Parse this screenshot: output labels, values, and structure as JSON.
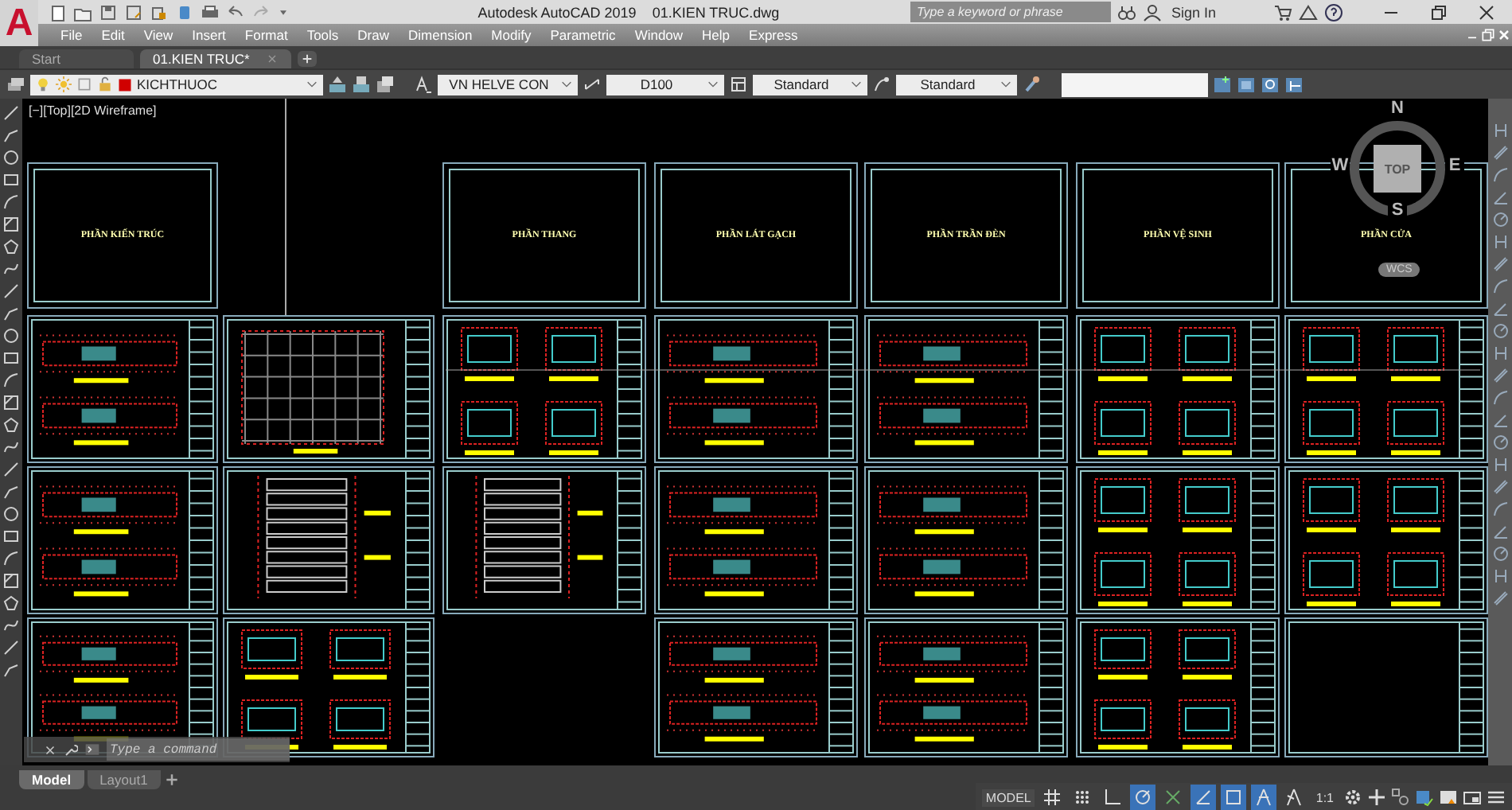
{
  "window": {
    "logo_letter": "A",
    "app_name": "Autodesk AutoCAD 2019",
    "file_name": "01.KIEN TRUC.dwg"
  },
  "search": {
    "placeholder": "Type a keyword or phrase"
  },
  "account": {
    "label": "Sign In"
  },
  "menu": [
    "File",
    "Edit",
    "View",
    "Insert",
    "Format",
    "Tools",
    "Draw",
    "Dimension",
    "Modify",
    "Parametric",
    "Window",
    "Help",
    "Express"
  ],
  "document_tabs": [
    {
      "label": "Start",
      "selected": false
    },
    {
      "label": "01.KIEN TRUC*",
      "selected": true
    }
  ],
  "properties_toolbar": {
    "layer": "KICHTHUOC",
    "text_style": "VN HELVE CON",
    "dimension_style": "D100",
    "table_style": "Standard",
    "multileader_style": "Standard"
  },
  "viewport": {
    "label": "[−][Top][2D Wireframe]"
  },
  "sheet_columns": [
    {
      "title": "PHẦN KIẾN TRÚC",
      "sheets": [
        {
          "kind": "floor-plan"
        },
        {
          "kind": "floor-plan"
        },
        {
          "kind": "floor-plan"
        }
      ]
    },
    {
      "sheets": [
        {
          "kind": "grid-plan"
        },
        {
          "kind": "section"
        },
        {
          "kind": "detail"
        }
      ]
    },
    {
      "title": "PHẦN THANG",
      "sheets": [
        {
          "kind": "detail"
        },
        {
          "kind": "section"
        }
      ]
    },
    {
      "title": "PHẦN LÁT GẠCH",
      "sheets": [
        {
          "kind": "floor-plan"
        },
        {
          "kind": "floor-plan"
        },
        {
          "kind": "floor-plan"
        }
      ]
    },
    {
      "title": "PHẦN TRẦN ĐÈN",
      "sheets": [
        {
          "kind": "floor-plan"
        },
        {
          "kind": "floor-plan"
        },
        {
          "kind": "floor-plan"
        }
      ]
    },
    {
      "title": "PHẦN VỆ SINH",
      "sheets": [
        {
          "kind": "detail"
        },
        {
          "kind": "detail"
        },
        {
          "kind": "detail"
        }
      ]
    },
    {
      "title": "PHẦN CỬA",
      "sheets": [
        {
          "kind": "detail"
        },
        {
          "kind": "detail"
        },
        {
          "kind": "blank"
        }
      ]
    }
  ],
  "view_cube": {
    "face": "TOP",
    "directions": [
      "N",
      "E",
      "S",
      "W"
    ],
    "coordinate_system": "WCS"
  },
  "command_line": {
    "placeholder": "Type a command"
  },
  "layout_tabs": [
    {
      "label": "Model",
      "selected": true
    },
    {
      "label": "Layout1",
      "selected": false
    }
  ],
  "status_bar": {
    "space": "MODEL",
    "scale": "1:1",
    "toggles": [
      {
        "kind": "grid",
        "on": false
      },
      {
        "kind": "snap",
        "on": false
      },
      {
        "kind": "ortho",
        "on": false
      },
      {
        "kind": "polar",
        "on": true
      },
      {
        "kind": "isodraft",
        "on": false
      },
      {
        "kind": "object-tracking",
        "on": true
      },
      {
        "kind": "object-snap",
        "on": true
      },
      {
        "kind": "annotation-visibility",
        "on": true
      },
      {
        "kind": "auto-scale",
        "on": false
      }
    ]
  }
}
